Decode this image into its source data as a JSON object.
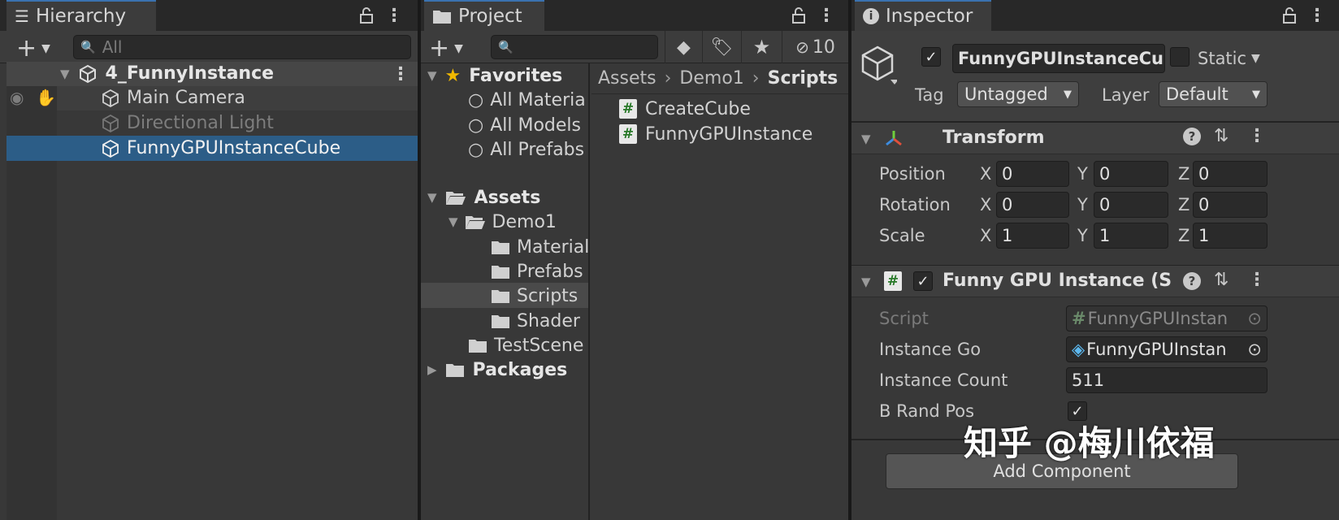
{
  "hierarchy": {
    "tab_label": "Hierarchy",
    "search_placeholder": "All",
    "scene_name": "4_FunnyInstance",
    "items": [
      {
        "label": "Main Camera"
      },
      {
        "label": "Directional Light"
      },
      {
        "label": "FunnyGPUInstanceCube"
      }
    ]
  },
  "project": {
    "tab_label": "Project",
    "hidden_count": "10",
    "favorites": {
      "label": "Favorites",
      "items": [
        "All Materia",
        "All Models",
        "All Prefabs"
      ]
    },
    "assets": {
      "label": "Assets",
      "demo1": "Demo1",
      "demo1_children": [
        "Material",
        "Prefabs",
        "Scripts",
        "Shader"
      ],
      "testscene": "TestScene",
      "packages": "Packages"
    },
    "breadcrumb": [
      "Assets",
      "Demo1",
      "Scripts"
    ],
    "files": [
      "CreateCube",
      "FunnyGPUInstance"
    ]
  },
  "inspector": {
    "tab_label": "Inspector",
    "object_name": "FunnyGPUInstanceCub",
    "static_label": "Static",
    "tag_label": "Tag",
    "tag_value": "Untagged",
    "layer_label": "Layer",
    "layer_value": "Default",
    "transform": {
      "title": "Transform",
      "rows": [
        {
          "label": "Position",
          "x": "0",
          "y": "0",
          "z": "0"
        },
        {
          "label": "Rotation",
          "x": "0",
          "y": "0",
          "z": "0"
        },
        {
          "label": "Scale",
          "x": "1",
          "y": "1",
          "z": "1"
        }
      ],
      "axis": {
        "x": "X",
        "y": "Y",
        "z": "Z"
      }
    },
    "script_component": {
      "title": "Funny GPU Instance (Scri",
      "script_label": "Script",
      "script_value": "FunnyGPUInstan",
      "instance_go_label": "Instance Go",
      "instance_go_value": "FunnyGPUInstan",
      "instance_count_label": "Instance Count",
      "instance_count_value": "511",
      "b_rand_pos_label": "B Rand Pos"
    },
    "add_component": "Add Component"
  },
  "watermark": "知乎 @梅川依福"
}
